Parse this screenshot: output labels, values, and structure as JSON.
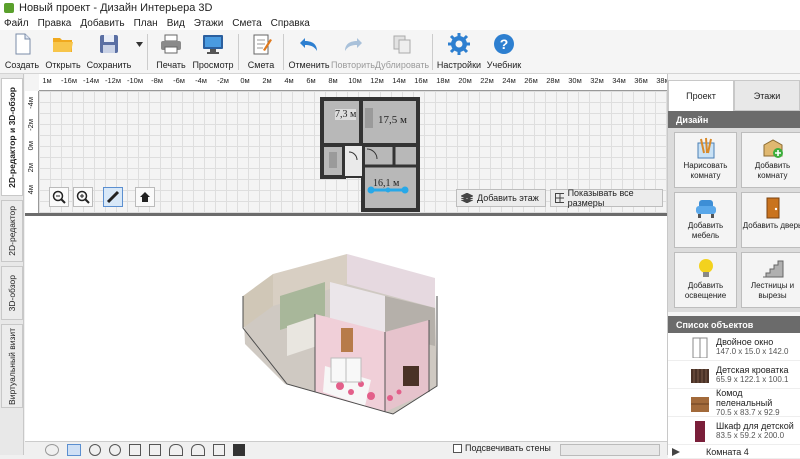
{
  "window": {
    "title": "Новый проект - Дизайн Интерьера 3D"
  },
  "menu": [
    "Файл",
    "Правка",
    "Добавить",
    "План",
    "Вид",
    "Этажи",
    "Смета",
    "Справка"
  ],
  "toolbar": {
    "create": "Создать",
    "open": "Открыть",
    "save": "Сохранить",
    "print": "Печать",
    "preview": "Просмотр",
    "estimate": "Смета",
    "undo": "Отменить",
    "redo": "Повторить",
    "duplicate": "Дублировать",
    "settings": "Настройки",
    "tutorial": "Учебник"
  },
  "left_tabs": [
    "2D-редактор и 3D-обзор",
    "2D-редактор",
    "3D-обзор",
    "Виртуальный визит"
  ],
  "ruler": {
    "h": [
      "1м",
      "-16м",
      "-14м",
      "-12м",
      "-10м",
      "-8м",
      "-6м",
      "-4м",
      "-2м",
      "0м",
      "2м",
      "4м",
      "6м",
      "8м",
      "10м",
      "12м",
      "14м",
      "16м",
      "18м",
      "20м",
      "22м",
      "24м",
      "26м",
      "28м",
      "30м",
      "32м",
      "34м",
      "36м",
      "38м"
    ],
    "v": [
      "-4м",
      "-2м",
      "0м",
      "2м",
      "4м"
    ]
  },
  "plan": {
    "room1_area": "7,3 м",
    "room2_area": "17,5 м",
    "room3_area": "16,1 м",
    "add_floor": "Добавить этаж",
    "show_sizes": "Показывать все размеры"
  },
  "right_panel": {
    "tab_project": "Проект",
    "tab_floors": "Этажи",
    "design_header": "Дизайн",
    "buttons": [
      "Нарисовать комнату",
      "Добавить комнату",
      "Добавить мебель",
      "Добавить дверь",
      "Добавить освещение",
      "Лестницы и вырезы"
    ],
    "objects_header": "Список объектов",
    "objects": [
      {
        "name": "Двойное окно",
        "dims": "147.0 x 15.0 x 142.0"
      },
      {
        "name": "Детская кроватка",
        "dims": "65.9 x 122.1 x 100.1"
      },
      {
        "name": "Комод пеленальный",
        "dims": "70.5 x 83.7 x 92.9"
      },
      {
        "name": "Шкаф для детской",
        "dims": "83.5 x 59.2 x 200.0"
      },
      {
        "name": "Комната 4",
        "dims": ""
      }
    ]
  },
  "bottom": {
    "checkbox_label": "Подсвечивать стены"
  },
  "colors": {
    "accent": "#2a6fc9",
    "header": "#6b6b6b"
  }
}
